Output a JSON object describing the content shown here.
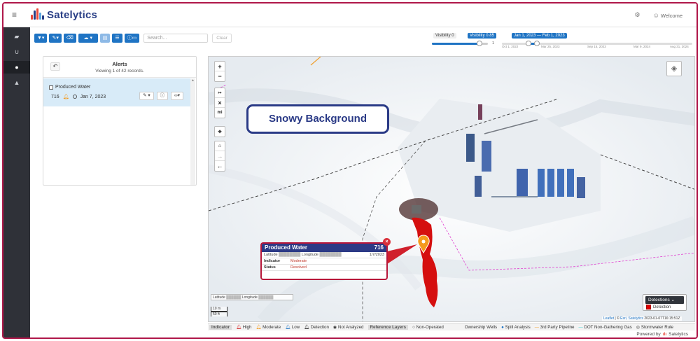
{
  "app": {
    "name": "Satelytics",
    "welcome": "Welcome",
    "powered_by": "Powered by",
    "powered_brand": "Satelytics"
  },
  "toolbar": {
    "search_placeholder": "Search...",
    "clear_label": "Clear"
  },
  "visibility": {
    "label_left": "Visibility 0",
    "label_right": "Visibility 0.85",
    "max_label": "1",
    "value": 0.85
  },
  "date_range": {
    "label": "Jan 1, 2023 — Feb 1, 2023",
    "ticks": [
      "Oct 1, 2022",
      "Mar 25, 2023",
      "Sep 15, 2023",
      "Mar 9, 2024",
      "Aug 31, 2024"
    ]
  },
  "alerts": {
    "title": "Alerts",
    "subtitle": "Viewing 1 of 42 records.",
    "items": [
      {
        "name": "Produced Water",
        "id": "716",
        "date": "Jan 7, 2023"
      }
    ]
  },
  "map": {
    "callout": "Snowy Background",
    "popup": {
      "title": "Produced Water",
      "id": "716",
      "lat_label": "Latitude",
      "lng_label": "Longitude",
      "date": "1/7/2023",
      "indicator_label": "Indicator",
      "indicator_value": "Moderate",
      "status_label": "Status",
      "status_value": "Resolved"
    },
    "latlng": {
      "lat_label": "Latitude",
      "lng_label": "Longitude"
    },
    "scale": {
      "metric": "10 m",
      "imperial": "50 ft"
    },
    "detections_legend": {
      "title": "Detections",
      "item": "Detection",
      "color": "#e00000"
    },
    "attribution": {
      "leaflet": "Leaflet",
      "esri": "Esri, Satelytics",
      "timestamp": "2023-01-07T16:15:51Z"
    }
  },
  "legend": {
    "indicator_title": "Indicator",
    "high": "High",
    "moderate": "Moderate",
    "low": "Low",
    "detection": "Detection",
    "not_analyzed": "Not Analyzed",
    "ref_title": "Reference Layers",
    "non_operated": "Non-Operated",
    "ownership_wells": "Ownership Wells",
    "spill_analysis": "Spill Analysis",
    "third_party": "3rd Party Pipeline",
    "dot_gas": "DOT Non-Gathering Gas",
    "stormwater": "Stormwater Rule"
  }
}
